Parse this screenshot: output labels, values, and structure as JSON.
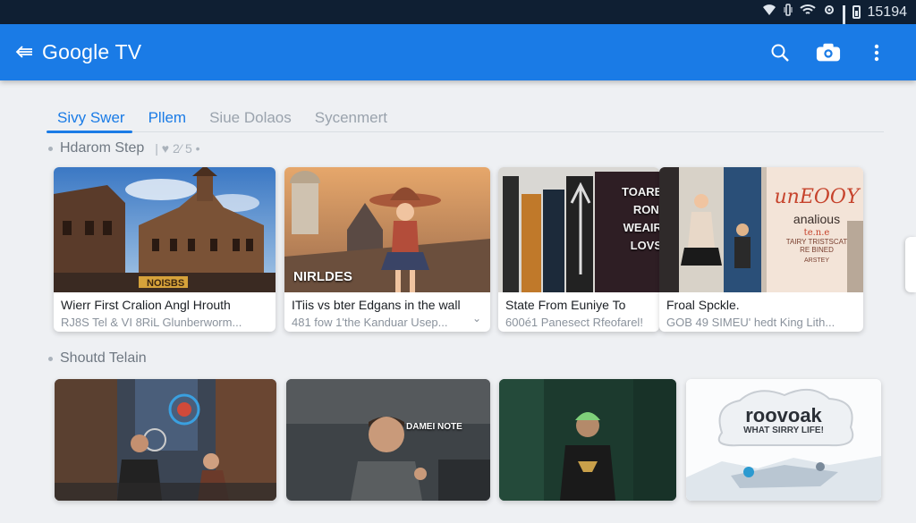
{
  "status": {
    "time": "15194"
  },
  "appbar": {
    "title": "Google TV",
    "back_icon": "back-arrow-icon",
    "search_icon": "search-icon",
    "camera_icon": "camera-icon",
    "more_icon": "more-vert-icon"
  },
  "tabs": [
    {
      "label": "Sivy Swer",
      "active": true
    },
    {
      "label": "Pllem",
      "active": false
    },
    {
      "label": "Siue Dolaos",
      "active": false
    },
    {
      "label": "Sycenmert",
      "active": false
    }
  ],
  "section1": {
    "title": "Hdarom Step",
    "meta": "| ♥ 2⁄ 5 •"
  },
  "section2": {
    "title": "Shoutd Telain"
  },
  "row1": [
    {
      "title": "Wierr First Cralion Angl Hrouth",
      "subtitle": "RJ8S Tel & VI 8RiL Glunberworm...",
      "overlay": "NOISBS"
    },
    {
      "title": "ITiis vs bter Edgans in the wall",
      "subtitle": "481 fow 1'the Kanduar Usep...",
      "overlay": "NIRLDES"
    },
    {
      "title": "State From Euniye To",
      "subtitle": "600é1 Panesect Rfeofarel!",
      "overlay_lines": [
        "TOARED",
        "RON",
        "WEAIRY",
        "LOVS"
      ]
    },
    {
      "title": "Froal Spckle.",
      "subtitle": "GOB 49 SIMEU' hedt King Lith...",
      "poster_lines": [
        "unEOOY",
        "analious",
        "te.n.e",
        "TAIRY TRISTSCAT",
        "RE BINED",
        "ARSTEY"
      ]
    }
  ],
  "row2": [
    {
      "overlay": ""
    },
    {
      "overlay": "DAMEI NOTE"
    },
    {
      "overlay": ""
    },
    {
      "logo": "roovoak",
      "tagline": "WHAT SIRRY LIFE!"
    }
  ],
  "colors": {
    "appbar": "#1a7be6",
    "statusbar": "#0f1f33",
    "background": "#eef0f3"
  }
}
